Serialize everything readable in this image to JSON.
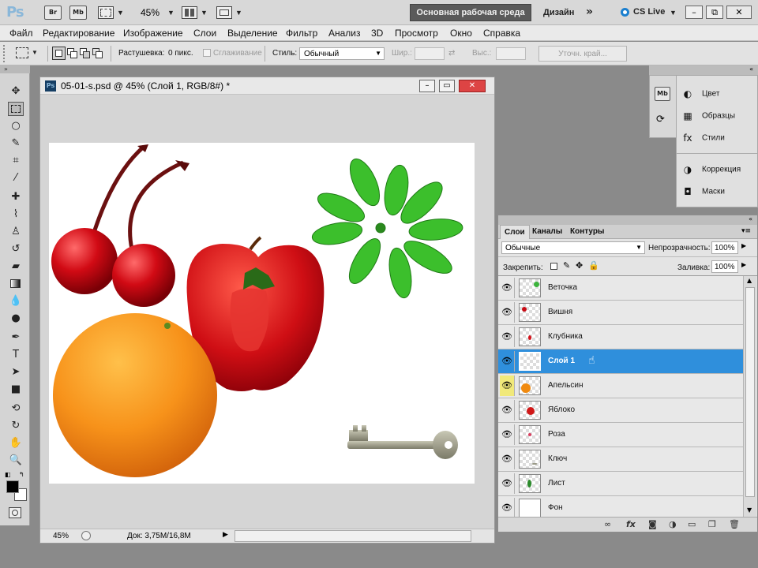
{
  "app": {
    "logo": "Ps",
    "bridge_label": "Br",
    "minibridge_label": "Mb",
    "zoom_value": "45%",
    "workspace_label": "Основная рабочая среда",
    "design_label": "Дизайн",
    "more_label": "»",
    "cslive_label": "CS Live",
    "minimize": "–",
    "restore": "⧉",
    "close": "✕"
  },
  "menu": [
    "Файл",
    "Редактирование",
    "Изображение",
    "Слои",
    "Выделение",
    "Фильтр",
    "Анализ",
    "3D",
    "Просмотр",
    "Окно",
    "Справка"
  ],
  "options": {
    "feather_label": "Растушевка:",
    "feather_value": "0 пикс.",
    "antialias_label": "Сглаживание",
    "style_label": "Стиль:",
    "style_value": "Обычный",
    "width_label": "Шир.:",
    "height_label": "Выс.:",
    "refine_label": "Уточн. край..."
  },
  "document": {
    "title": "05-01-s.psd @ 45% (Слой 1, RGB/8#) *",
    "zoom": "45%",
    "doc_size": "Док: 3,75M/16,8M"
  },
  "side_panel": {
    "items": [
      {
        "icon": "palette-icon",
        "glyph": "◐",
        "label": "Цвет"
      },
      {
        "icon": "swatches-icon",
        "glyph": "▦",
        "label": "Образцы"
      },
      {
        "icon": "fx-icon",
        "glyph": "fx",
        "label": "Стили"
      },
      {
        "icon": "adjustments-icon",
        "glyph": "◑",
        "label": "Коррекция"
      },
      {
        "icon": "masks-icon",
        "glyph": "◘",
        "label": "Маски"
      }
    ]
  },
  "layers_panel": {
    "tabs": [
      "Слои",
      "Каналы",
      "Контуры"
    ],
    "blend_mode": "Обычные",
    "opacity_label": "Непрозрачность:",
    "opacity_value": "100%",
    "lock_label": "Закрепить:",
    "fill_label": "Заливка:",
    "fill_value": "100%",
    "layers": [
      {
        "name": "Веточка",
        "thumb_color": "#3cb43c",
        "selected": false
      },
      {
        "name": "Вишня",
        "thumb_color": "#c80a14",
        "selected": false
      },
      {
        "name": "Клубника",
        "thumb_color": "#d41018",
        "selected": false
      },
      {
        "name": "Слой 1",
        "thumb_color": "",
        "selected": true
      },
      {
        "name": "Апельсин",
        "thumb_color": "#f08a10",
        "selected": false
      },
      {
        "name": "Яблоко",
        "thumb_color": "#d01818",
        "selected": false
      },
      {
        "name": "Роза",
        "thumb_color": "#d84060",
        "selected": false
      },
      {
        "name": "Ключ",
        "thumb_color": "#9a9a88",
        "selected": false
      },
      {
        "name": "Лист",
        "thumb_color": "#2a8a2a",
        "selected": false
      },
      {
        "name": "Фон",
        "thumb_color": "",
        "selected": false
      }
    ]
  },
  "colors": {
    "accent": "#2f8fdc",
    "highlight_eye": "#f1e97a",
    "workspace_btn": "#5a5a5a"
  }
}
